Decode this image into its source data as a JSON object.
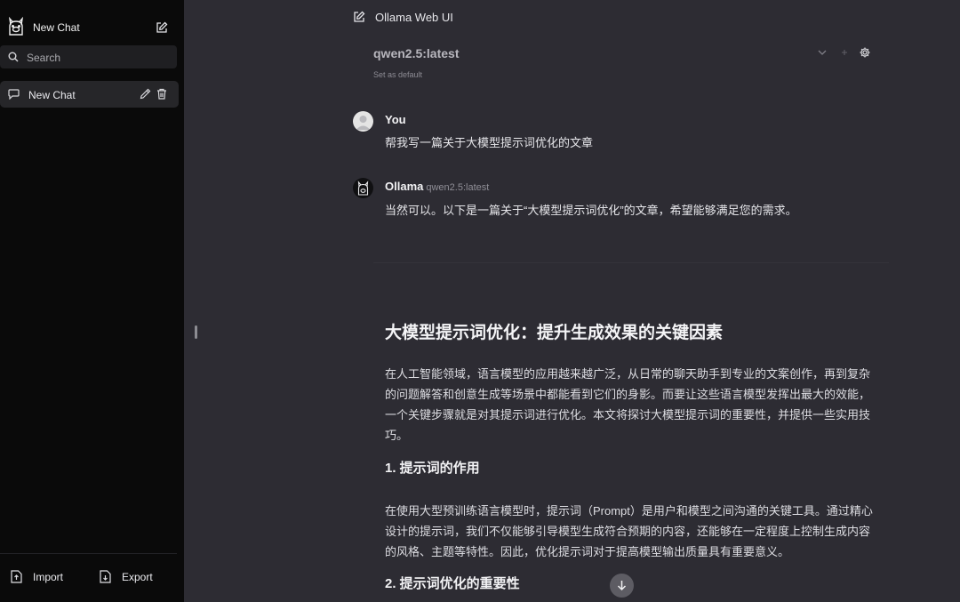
{
  "sidebar": {
    "title": "New Chat",
    "search_placeholder": "Search",
    "chats": [
      {
        "label": "New Chat"
      }
    ],
    "import_label": "Import",
    "export_label": "Export"
  },
  "header": {
    "title": "Ollama Web UI",
    "model": "qwen2.5:latest",
    "set_default": "Set as default"
  },
  "messages": [
    {
      "sender": "You",
      "text": "帮我写一篇关于大模型提示词优化的文章"
    },
    {
      "sender": "Ollama",
      "model": "qwen2.5:latest",
      "text": "当然可以。以下是一篇关于“大模型提示词优化”的文章，希望能够满足您的需求。"
    }
  ],
  "article": {
    "title": "大模型提示词优化：提升生成效果的关键因素",
    "intro_lines": [
      "在人工智能领域，语言模型的应用越来越广泛，从日常的聊天助手到专业的文案创作，再到复杂",
      "的问题解答和创意生成等场景中都能看到它们的身影。而要让这些语言模型发挥出最大的效能，",
      "一个关键步骤就是对其提示词进行优化。本文将探讨大模型提示词的重要性，并提供一些实用技",
      "巧。"
    ],
    "section1_title": "1. 提示词的作用",
    "section1_lines": [
      "在使用大型预训练语言模型时，提示词（Prompt）是用户和模型之间沟通的关键工具。通过精心",
      "设计的提示词，我们不仅能够引导模型生成符合预期的内容，还能够在一定程度上控制生成内容",
      "的风格、主题等特性。因此，优化提示词对于提高模型输出质量具有重要意义。"
    ],
    "section2_title": "2. 提示词优化的重要性"
  },
  "colors": {
    "sidebar_bg": "#0a0a0a",
    "main_bg": "#2d2c33",
    "active_chat_bg": "#262629"
  }
}
